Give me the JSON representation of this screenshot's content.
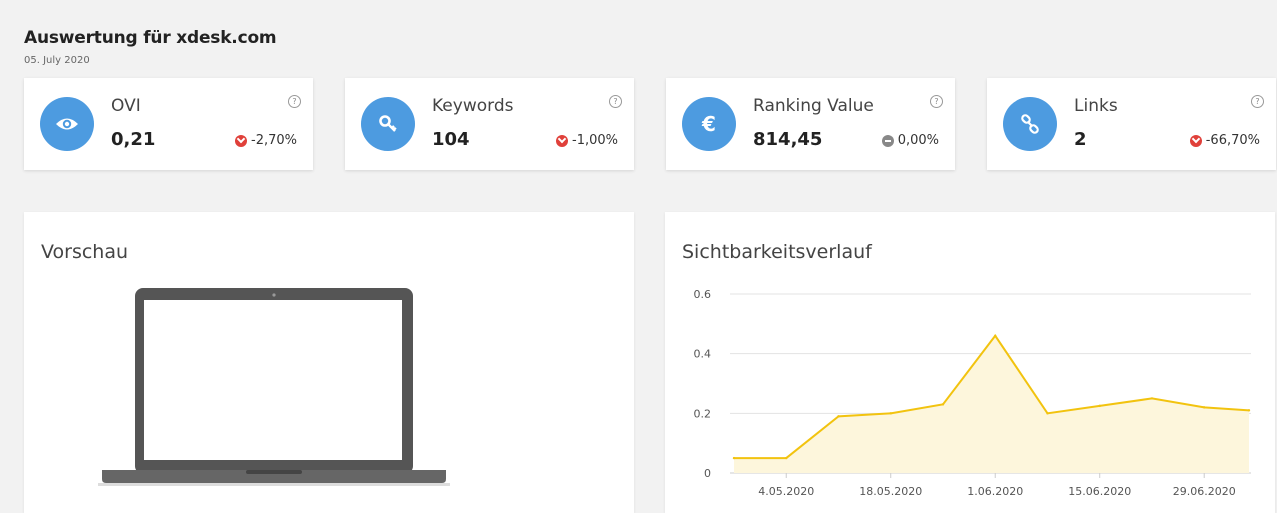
{
  "header": {
    "title": "Auswertung für xdesk.com",
    "date": "05. July 2020"
  },
  "kpis": [
    {
      "icon": "eye-icon",
      "label": "OVI",
      "value": "0,21",
      "change": "-2,70%",
      "trend": "down"
    },
    {
      "icon": "key-icon",
      "label": "Keywords",
      "value": "104",
      "change": "-1,00%",
      "trend": "down"
    },
    {
      "icon": "euro-icon",
      "label": "Ranking Value",
      "value": "814,45",
      "change": "0,00%",
      "trend": "neutral"
    },
    {
      "icon": "link-icon",
      "label": "Links",
      "value": "2",
      "change": "-66,70%",
      "trend": "down"
    }
  ],
  "help_symbol": "?",
  "euro_symbol": "€",
  "preview": {
    "title": "Vorschau"
  },
  "visibility": {
    "title": "Sichtbarkeitsverlauf"
  },
  "colors": {
    "accent": "#4d9be0",
    "line": "#f2c30f",
    "area": "#fdf6dc",
    "down": "#e0403a",
    "neutral": "#888888"
  },
  "chart_data": {
    "type": "area",
    "title": "Sichtbarkeitsverlauf",
    "x": [
      "2020-04-27",
      "2020-05-04",
      "2020-05-11",
      "2020-05-18",
      "2020-05-25",
      "2020-06-01",
      "2020-06-08",
      "2020-06-15",
      "2020-06-22",
      "2020-06-29",
      "2020-07-05"
    ],
    "series": [
      {
        "values": [
          0.05,
          0.05,
          0.19,
          0.2,
          0.23,
          0.46,
          0.2,
          0.225,
          0.25,
          0.22,
          0.21
        ]
      }
    ],
    "x_ticks": [
      "4.05.2020",
      "18.05.2020",
      "1.06.2020",
      "15.06.2020",
      "29.06.2020"
    ],
    "y_ticks": [
      "0",
      "0.2",
      "0.4",
      "0.6"
    ],
    "ylim": [
      0,
      0.6
    ],
    "grid": true
  }
}
